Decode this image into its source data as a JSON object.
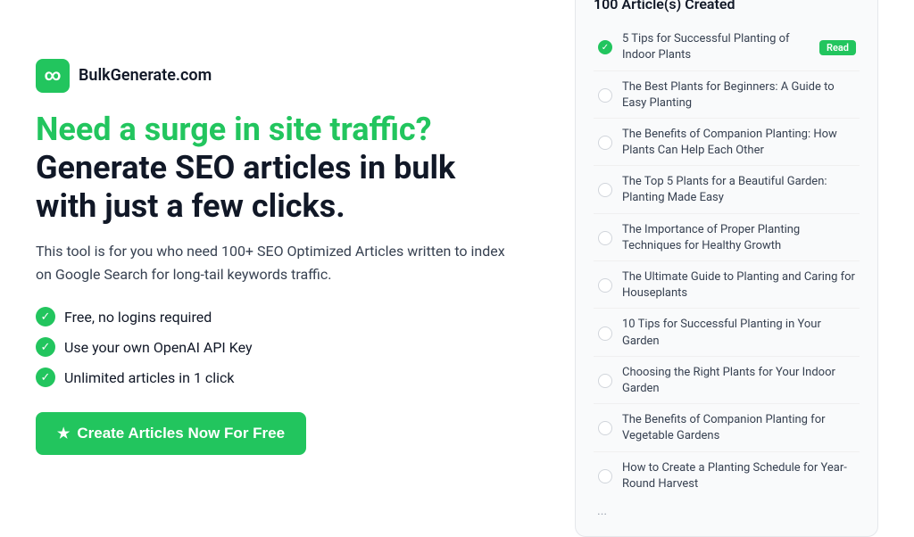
{
  "brand": {
    "logo_symbol": "∞",
    "name": "BulkGenerate.com"
  },
  "hero": {
    "headline_green": "Need a surge in site traffic?",
    "headline_black": " Generate SEO articles in bulk with just a few clicks.",
    "subheadline": "This tool is for you who need 100+ SEO Optimized Articles written to index on Google Search for long-tail keywords traffic."
  },
  "features": [
    {
      "text": "Free, no logins required"
    },
    {
      "text": "Use your own OpenAI API Key"
    },
    {
      "text": "Unlimited articles in 1 click"
    }
  ],
  "cta": {
    "label": "Create Articles Now For Free"
  },
  "articles_card": {
    "title": "100 Article(s) Created",
    "articles": [
      {
        "text": "5 Tips for Successful Planting of Indoor Plants",
        "status": "done",
        "badge": "Read"
      },
      {
        "text": "The Best Plants for Beginners: A Guide to Easy Planting",
        "status": "empty",
        "badge": null
      },
      {
        "text": "The Benefits of Companion Planting: How Plants Can Help Each Other",
        "status": "empty",
        "badge": null
      },
      {
        "text": "The Top 5 Plants for a Beautiful Garden: Planting Made Easy",
        "status": "empty",
        "badge": null
      },
      {
        "text": "The Importance of Proper Planting Techniques for Healthy Growth",
        "status": "empty",
        "badge": null
      },
      {
        "text": "The Ultimate Guide to Planting and Caring for Houseplants",
        "status": "empty",
        "badge": null
      },
      {
        "text": "10 Tips for Successful Planting in Your Garden",
        "status": "empty",
        "badge": null
      },
      {
        "text": "Choosing the Right Plants for Your Indoor Garden",
        "status": "empty",
        "badge": null
      },
      {
        "text": "The Benefits of Companion Planting for Vegetable Gardens",
        "status": "empty",
        "badge": null
      },
      {
        "text": "How to Create a Planting Schedule for Year-Round Harvest",
        "status": "empty",
        "badge": null
      }
    ],
    "more": "..."
  }
}
